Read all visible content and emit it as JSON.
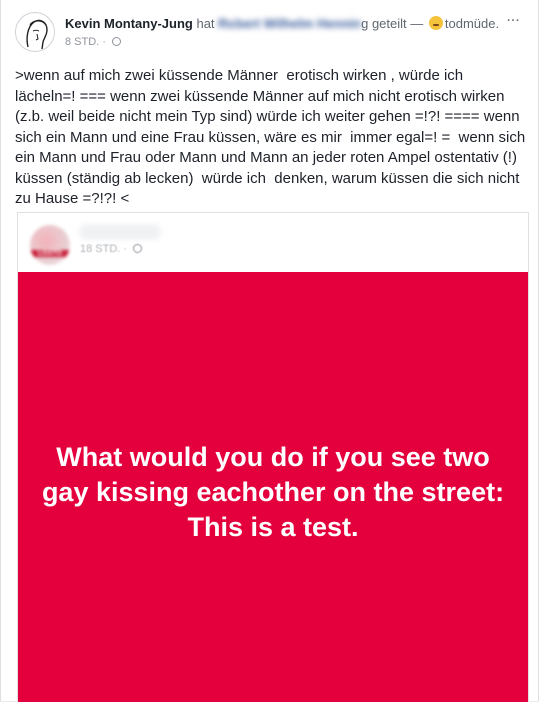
{
  "post": {
    "author": "Kevin Montany-Jung",
    "action_prefix": "hat",
    "shared_name": "Ro",
    "shared_name_end": "g",
    "action_suffix": "geteilt —",
    "feeling": "todmüde.",
    "timestamp": "8 STD.",
    "separator": "·",
    "more_label": "...",
    "body": ">wenn auf mich zwei küssende Männer  erotisch wirken , würde ich lächeln=! === wenn zwei küssende Männer auf mich nicht erotisch wirken (z.b. weil beide nicht mein Typ sind) würde ich weiter gehen =!?! ==== wenn sich ein Mann und eine Frau küssen, wäre es mir  immer egal=! =  wenn sich ein Mann und Frau oder Mann und Mann an jeder roten Ampel ostentativ (!) küssen (ständig ab lecken)  würde ich  denken, warum küssen die sich nicht zu Hause =?!?! <"
  },
  "shared_post": {
    "avatar_label": "LGSTO",
    "timestamp": "18 STD.",
    "separator": "·",
    "image_text": "What would you do if you see two gay kissing eachother on the street:\nThis is a test.",
    "panel_color": "#e4003c"
  }
}
